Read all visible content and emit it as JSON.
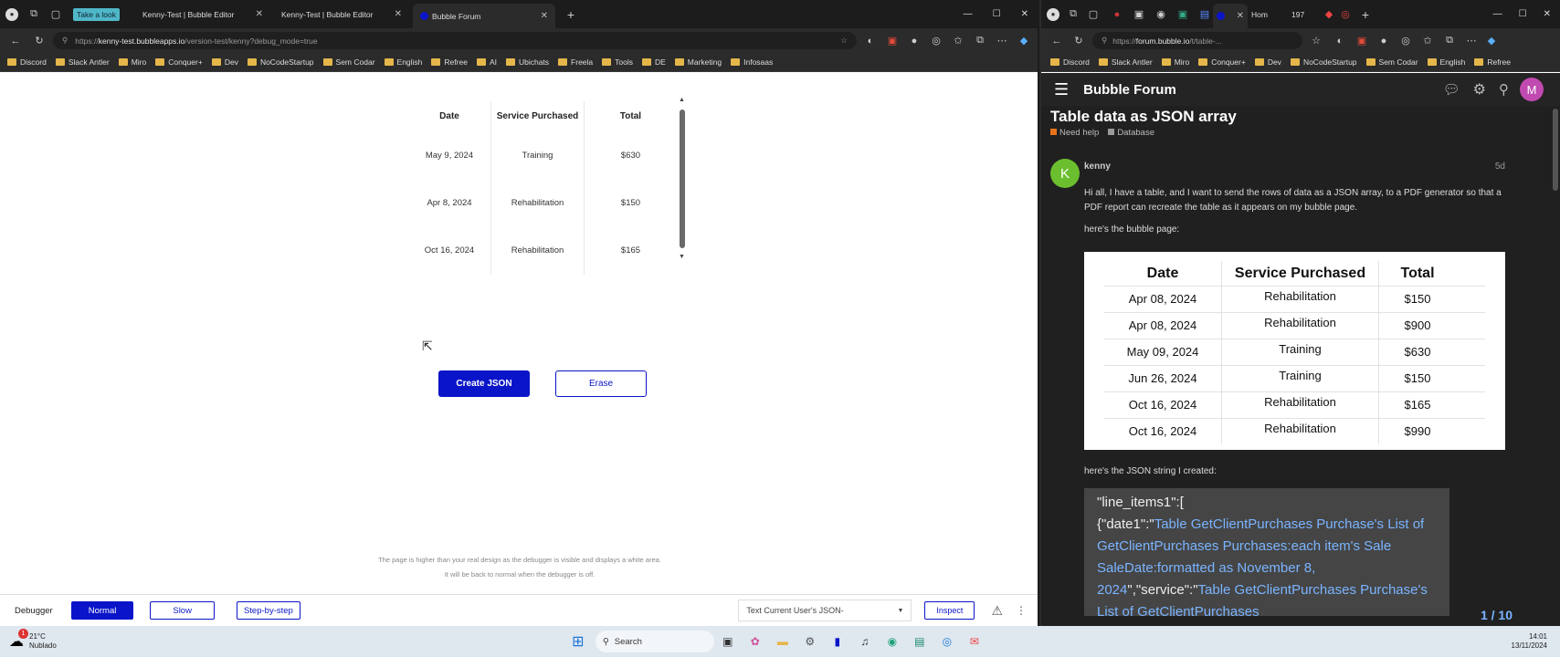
{
  "left_window": {
    "tabs": [
      {
        "label": "Take a look"
      },
      {
        "label": "Kenny-Test | Bubble Editor"
      },
      {
        "label": "Kenny-Test | Bubble Editor"
      },
      {
        "label": "Bubble Forum"
      }
    ],
    "url_prefix": "https://",
    "url_domain": "kenny-test.bubbleapps.io",
    "url_rest": "/version-test/kenny?debug_mode=true",
    "bookmarks": [
      {
        "label": "Discord",
        "icon": "discord-icon"
      },
      {
        "label": "Slack Antler",
        "icon": "slack-icon"
      },
      {
        "label": "Miro",
        "icon": "miro-icon"
      },
      {
        "label": "Conquer+",
        "icon": "conquer-icon"
      },
      {
        "label": "Dev",
        "icon": "folder-icon"
      },
      {
        "label": "NoCodeStartup",
        "icon": "folder-icon"
      },
      {
        "label": "Sem Codar",
        "icon": "folder-icon"
      },
      {
        "label": "English",
        "icon": "folder-icon"
      },
      {
        "label": "Refree",
        "icon": "folder-icon"
      },
      {
        "label": "AI",
        "icon": "folder-icon"
      },
      {
        "label": "Ubichats",
        "icon": "folder-icon"
      },
      {
        "label": "Freela",
        "icon": "folder-icon"
      },
      {
        "label": "Tools",
        "icon": "folder-icon"
      },
      {
        "label": "DE",
        "icon": "folder-icon"
      },
      {
        "label": "Marketing",
        "icon": "folder-icon"
      },
      {
        "label": "Infosaas",
        "icon": "infosaas-icon"
      }
    ],
    "table": {
      "headers": [
        "Date",
        "Service Purchased",
        "Total"
      ],
      "rows": [
        [
          "May 9, 2024",
          "Training",
          "$630"
        ],
        [
          "Apr 8, 2024",
          "Rehabilitation",
          "$150"
        ],
        [
          "Oct 16, 2024",
          "Rehabilitation",
          "$165"
        ]
      ]
    },
    "buttons": {
      "create": "Create JSON",
      "erase": "Erase"
    },
    "debugger_note_1": "The page is higher than your real design as the debugger is visible and displays a white area.",
    "debugger_note_2": "It will be back to normal when the debugger is off.",
    "debugger": {
      "label": "Debugger",
      "modes": [
        "Normal",
        "Slow",
        "Step-by-step"
      ],
      "select_value": "Text Current User's JSON-",
      "inspect": "Inspect"
    }
  },
  "right_window": {
    "tabs": [
      {
        "label": "Hom"
      },
      {
        "label": "197"
      }
    ],
    "url_prefix": "https://",
    "url_domain": "forum.bubble.io",
    "url_rest": "/t/table-...",
    "bookmarks": [
      {
        "label": "Discord"
      },
      {
        "label": "Slack Antler"
      },
      {
        "label": "Miro"
      },
      {
        "label": "Conquer+"
      },
      {
        "label": "Dev"
      },
      {
        "label": "NoCodeStartup"
      },
      {
        "label": "Sem Codar"
      },
      {
        "label": "English"
      },
      {
        "label": "Refree"
      }
    ],
    "forum_name": "Bubble Forum",
    "avatar_letter": "M",
    "post": {
      "title": "Table data as JSON array",
      "categories": [
        {
          "label": "Need help",
          "color": "#e8731a"
        },
        {
          "label": "Database",
          "color": "#9a9a9a"
        }
      ],
      "author": "kenny",
      "author_initial": "K",
      "age": "5d",
      "body_1": "Hi all, I have a table, and I want to send the rows of data as a JSON array, to a PDF generator so that a PDF report can recreate the table as it appears on my bubble page.",
      "body_2": "here's the bubble page:",
      "image_table": {
        "headers": [
          "Date",
          "Service Purchased",
          "Total"
        ],
        "rows": [
          [
            "Apr 08, 2024",
            "Rehabilitation",
            "$150"
          ],
          [
            "Apr 08, 2024",
            "Rehabilitation",
            "$900"
          ],
          [
            "May 09, 2024",
            "Training",
            "$630"
          ],
          [
            "Jun 26, 2024",
            "Training",
            "$150"
          ],
          [
            "Oct 16, 2024",
            "Rehabilitation",
            "$165"
          ],
          [
            "Oct 16, 2024",
            "Rehabilitation",
            "$990"
          ]
        ]
      },
      "body_3": "here's the JSON string I created:",
      "code_1": "\"line_items1\":[",
      "code_2": "{\"date1\":\"",
      "code_3": "Table GetClientPurchases Purchase's List of GetClientPurchases Purchases:each item's Sale SaleDate:formatted as November 8, 2024",
      "code_4": "\",\"service\":\"",
      "code_5": "Table GetClientPurchases Purchase's List of GetClientPurchases"
    },
    "pager": "1 / 10"
  },
  "taskbar": {
    "weather_temp": "21°C",
    "weather_desc": "Nublado",
    "weather_badge": "1",
    "search": "Search",
    "time": "14:01",
    "date": "13/11/2024"
  },
  "colors": {
    "bubble_blue": "#0a14c8",
    "link_blue": "#7ab4ff"
  }
}
